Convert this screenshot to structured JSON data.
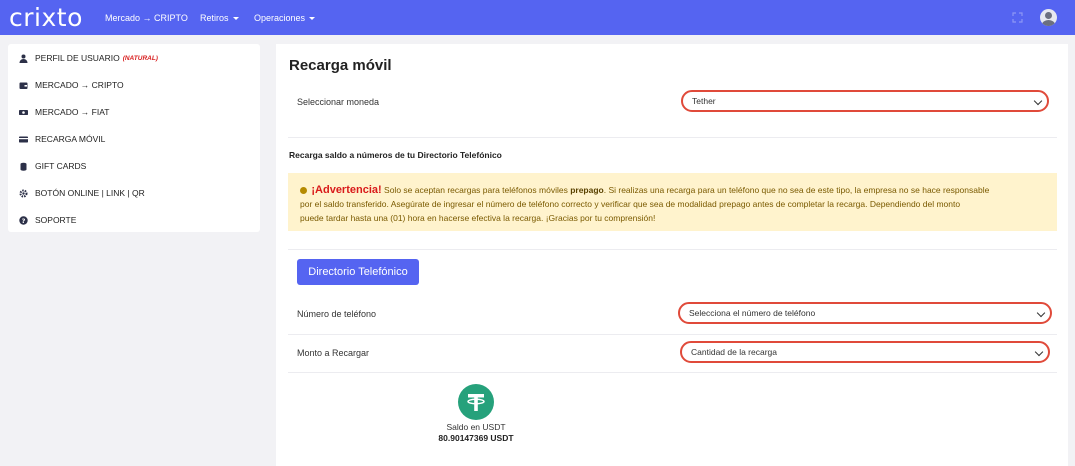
{
  "brand": {
    "logo_text": "crixto",
    "color": "#5564f1"
  },
  "topnav": {
    "links": [
      {
        "label": "Mercado → CRIPTO",
        "has_caret": false
      },
      {
        "label": "Retiros",
        "has_caret": true
      },
      {
        "label": "Operaciones",
        "has_caret": true
      }
    ],
    "icons": [
      "fullscreen-icon",
      "user-avatar"
    ]
  },
  "sidebar": {
    "items": [
      {
        "label": "PERFIL DE USUARIO",
        "tag": "(NATURAL)",
        "icon": "user-icon"
      },
      {
        "label": "MERCADO → CRIPTO",
        "icon": "wallet-icon"
      },
      {
        "label": "MERCADO → FIAT",
        "icon": "money-icon"
      },
      {
        "label": "RECARGA MÓVIL",
        "icon": "card-icon"
      },
      {
        "label": "GIFT CARDS",
        "icon": "coins-icon"
      },
      {
        "label": "BOTÓN ONLINE | LINK | QR",
        "icon": "gear-icon"
      },
      {
        "label": "SOPORTE",
        "icon": "question-icon"
      }
    ]
  },
  "main": {
    "title": "Recarga móvil",
    "currency": {
      "label": "Seleccionar moneda",
      "value": "Tether"
    },
    "section_heading": "Recarga saldo a números de tu Directorio Telefónico",
    "warning": {
      "title": "¡Advertencia!",
      "text_1": " Solo se aceptan recargas para teléfonos móviles ",
      "bold": "prepago",
      "text_2": ". Si realizas una recarga para un teléfono que no sea de este tipo, la empresa no se hace responsable",
      "line_2": "por el saldo transferido. Asegúrate de ingresar el número de teléfono correcto y verificar que sea de modalidad prepago antes de completar la recarga. Dependiendo del monto",
      "line_3": "puede tardar hasta una (01) hora en hacerse efectiva la recarga. ¡Gracias por tu comprensión!"
    },
    "directory_button": "Directorio Telefónico",
    "phone": {
      "label": "Número de teléfono",
      "value": "Selecciona el número de teléfono"
    },
    "amount": {
      "label": "Monto a Recargar",
      "value": "Cantidad de la recarga"
    },
    "balance": {
      "icon": "tether-icon",
      "label": "Saldo en USDT",
      "value": "80.90147369 USDT"
    }
  }
}
